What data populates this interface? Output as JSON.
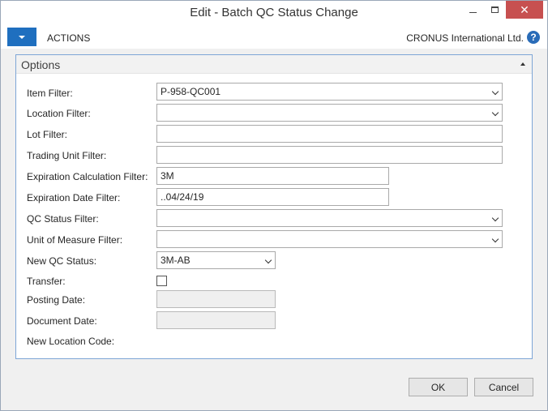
{
  "window": {
    "title": "Edit - Batch QC Status Change",
    "close_glyph": "✕"
  },
  "actionbar": {
    "actions_label": "ACTIONS",
    "company": "CRONUS International Ltd.",
    "help_glyph": "?"
  },
  "options": {
    "title": "Options",
    "fields": {
      "item_filter": {
        "label": "Item Filter:",
        "value": "P-958-QC001"
      },
      "location_filter": {
        "label": "Location Filter:",
        "value": ""
      },
      "lot_filter": {
        "label": "Lot Filter:",
        "value": ""
      },
      "trading_unit_filter": {
        "label": "Trading Unit Filter:",
        "value": ""
      },
      "expiration_calc_filter": {
        "label": "Expiration Calculation Filter:",
        "value": "3M"
      },
      "expiration_date_filter": {
        "label": "Expiration Date Filter:",
        "value": "..04/24/19"
      },
      "qc_status_filter": {
        "label": "QC Status Filter:",
        "value": ""
      },
      "uom_filter": {
        "label": "Unit of Measure Filter:",
        "value": ""
      },
      "new_qc_status": {
        "label": "New QC Status:",
        "value": "3M-AB"
      },
      "transfer": {
        "label": "Transfer:",
        "checked": false
      },
      "posting_date": {
        "label": "Posting Date:",
        "value": ""
      },
      "document_date": {
        "label": "Document Date:",
        "value": ""
      },
      "new_location_code": {
        "label": "New Location Code:"
      }
    }
  },
  "buttons": {
    "ok": "OK",
    "cancel": "Cancel"
  }
}
